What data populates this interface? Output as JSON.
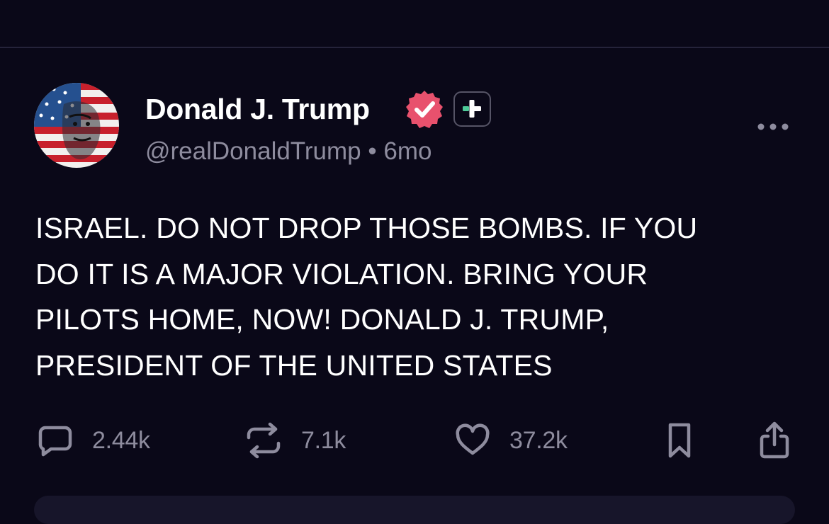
{
  "post": {
    "author_name": "Donald J. Trump",
    "handle": "@realDonaldTrump",
    "separator": "•",
    "age": "6mo",
    "text": "ISRAEL. DO NOT DROP THOSE BOMBS. IF YOU\nDO IT IS A MAJOR VIOLATION. BRING YOUR\nPILOTS HOME, NOW! DONALD J. TRUMP,\nPRESIDENT OF THE UNITED STATES"
  },
  "actions": {
    "replies": "2.44k",
    "reposts": "7.1k",
    "likes": "37.2k"
  },
  "icons": {
    "avatar": "profile-avatar",
    "verified": "verified-badge-icon",
    "plus": "plus-badge-icon",
    "more": "more-dots-icon",
    "reply": "comment-bubble-icon",
    "repost": "repost-arrows-icon",
    "like": "heart-icon",
    "bookmark": "bookmark-icon",
    "share": "share-icon"
  },
  "colors": {
    "background": "#0a0818",
    "text": "#ffffff",
    "muted": "#8e8c9e",
    "verified": "#e8516d",
    "plus_accent": "#4ecb99",
    "divider": "#25233a"
  }
}
